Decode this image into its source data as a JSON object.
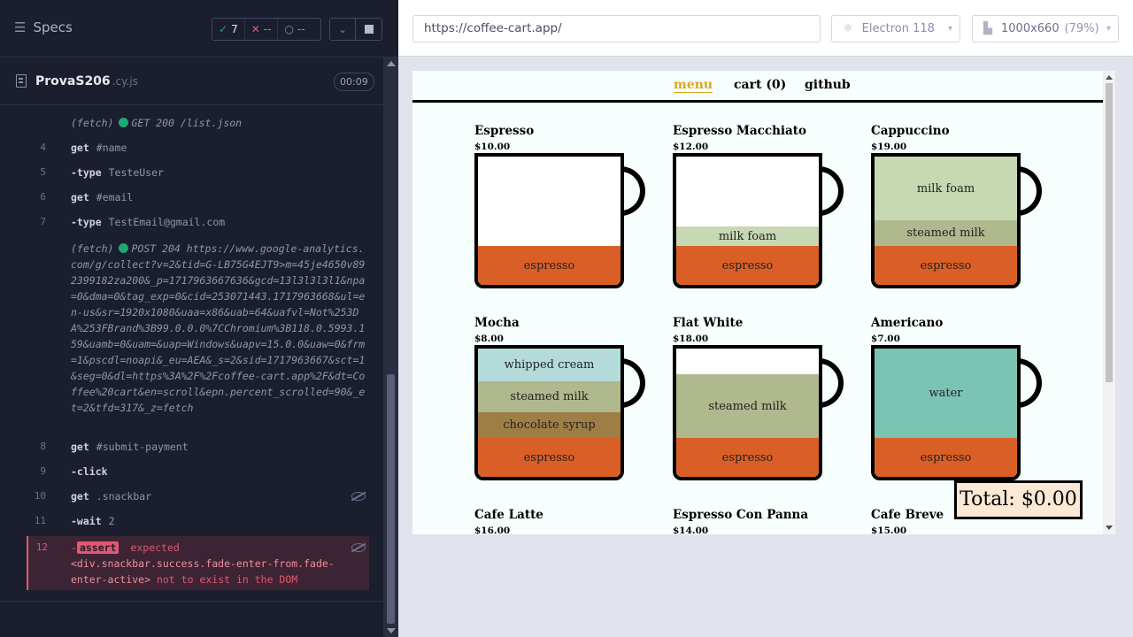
{
  "reporter": {
    "specs_label": "Specs",
    "stats": {
      "passed": "7",
      "failed": "--",
      "pending": "--"
    },
    "spec": {
      "name": "ProvaS206",
      "ext": ".cy.js",
      "duration": "00:09"
    },
    "commands": {
      "fetch1": {
        "label": "(fetch)",
        "text": "GET 200 /list.json"
      },
      "c4": {
        "num": "4",
        "name": "get",
        "arg": "#name"
      },
      "c5": {
        "num": "5",
        "name": "-type",
        "arg": "TesteUser"
      },
      "c6": {
        "num": "6",
        "name": "get",
        "arg": "#email"
      },
      "c7": {
        "num": "7",
        "name": "-type",
        "arg": "TestEmail@gmail.com"
      },
      "fetch2": {
        "label": "(fetch)",
        "text": "POST 204 https://www.google-analytics.com/g/collect?v=2&tid=G-LB75G4EJT9>m=45je4650v892399182za200&_p=1717963667636&gcd=13l3l3l3l1&npa=0&dma=0&tag_exp=0&cid=253071443.1717963668&ul=en-us&sr=1920x1080&uaa=x86&uab=64&uafvl=Not%253DA%253FBrand%3B99.0.0.0%7CChromium%3B118.0.5993.159&uamb=0&uam=&uap=Windows&uapv=15.0.0&uaw=0&frm=1&pscdl=noapi&_eu=AEA&_s=2&sid=1717963667&sct=1&seg=0&dl=https%3A%2F%2Fcoffee-cart.app%2F&dt=Coffee%20cart&en=scroll&epn.percent_scrolled=90&_et=2&tfd=317&_z=fetch"
      },
      "c8": {
        "num": "8",
        "name": "get",
        "arg": "#submit-payment"
      },
      "c9": {
        "num": "9",
        "name": "-click",
        "arg": ""
      },
      "c10": {
        "num": "10",
        "name": "get",
        "arg": ".snackbar"
      },
      "c11": {
        "num": "11",
        "name": "-wait",
        "arg": "2"
      },
      "c12": {
        "num": "12",
        "prefix": "-",
        "badge": "assert",
        "text1": "expected",
        "element": "<div.snackbar.success.fade-enter-from.fade-enter-active>",
        "text2": "not to exist in the DOM"
      }
    }
  },
  "aut_header": {
    "url": "https://coffee-cart.app/",
    "browser": "Electron 118",
    "viewport": "1000x660",
    "zoom": "(79%)"
  },
  "app": {
    "nav": {
      "menu": "menu",
      "cart": "cart (0)",
      "github": "github"
    },
    "products": [
      {
        "name": "Espresso",
        "price": "$10.00",
        "layers": [
          "espresso"
        ]
      },
      {
        "name": "Espresso Macchiato",
        "price": "$12.00",
        "layers": [
          "espresso",
          "milk foam"
        ]
      },
      {
        "name": "Cappuccino",
        "price": "$19.00",
        "layers": [
          "espresso",
          "steamed milk",
          "milk foam"
        ]
      },
      {
        "name": "Mocha",
        "price": "$8.00",
        "layers": [
          "espresso",
          "chocolate syrup",
          "steamed milk",
          "whipped cream"
        ]
      },
      {
        "name": "Flat White",
        "price": "$18.00",
        "layers": [
          "espresso",
          "steamed milk"
        ]
      },
      {
        "name": "Americano",
        "price": "$7.00",
        "layers": [
          "espresso",
          "water"
        ]
      },
      {
        "name": "Cafe Latte",
        "price": "$16.00"
      },
      {
        "name": "Espresso Con Panna",
        "price": "$14.00"
      },
      {
        "name": "Cafe Breve",
        "price": "$15.00"
      }
    ],
    "total": "Total: $0.00"
  }
}
